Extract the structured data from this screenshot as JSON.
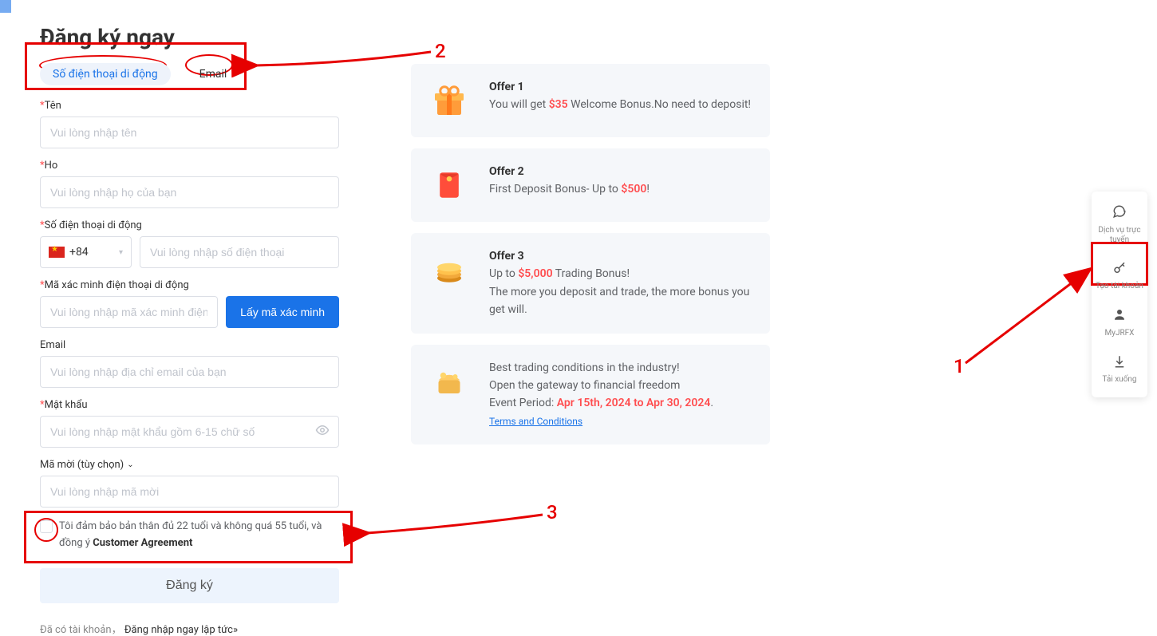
{
  "page_title": "Đăng ký ngay",
  "tabs": {
    "mobile": "Số điện thoại di động",
    "email": "Email"
  },
  "form": {
    "name_label": "Tên",
    "name_ph": "Vui lòng nhập tên",
    "lastname_label": "Ho",
    "lastname_ph": "Vui lòng nhập họ của bạn",
    "phone_label": "Số điện thoại di động",
    "phone_prefix": "+84",
    "phone_ph": "Vui lòng nhập số điện thoại",
    "verify_label": "Mã xác minh điện thoại di động",
    "verify_ph": "Vui lòng nhập mã xác minh điện thoại di động",
    "verify_btn": "Lấy mã xác minh",
    "email_label": "Email",
    "email_ph": "Vui lòng nhập địa chỉ email của bạn",
    "pw_label": "Mật khẩu",
    "pw_ph": "Vui lòng nhập mật khẩu gồm 6-15 chữ số",
    "invite_label": "Mã mời (tùy chọn)",
    "invite_ph": "Vui lòng nhập mã mời",
    "agree_text": "Tôi đảm bảo bản thân đủ 22 tuổi và không quá 55 tuổi, và đồng ý ",
    "agree_link": "Customer Agreement",
    "register_btn": "Đăng ký",
    "already_text": "Đã có tài khoản，",
    "login_now": "Đăng nhập ngay lập tức»"
  },
  "offers": {
    "o1_title": "Offer 1",
    "o1_pre": "You will get ",
    "o1_amt": "$35",
    "o1_post": " Welcome Bonus.No need to deposit!",
    "o2_title": "Offer 2",
    "o2_pre": "First Deposit Bonus- Up to ",
    "o2_amt": "$500",
    "o2_post": "!",
    "o3_title": "Offer 3",
    "o3_pre": "Up to ",
    "o3_amt": "$5,000",
    "o3_post": " Trading Bonus!",
    "o3_line2": "The more you deposit and trade, the more bonus you get will.",
    "o4_line1": "Best trading conditions in the industry!",
    "o4_line2": "Open the gateway to financial freedom",
    "o4_period_pre": "Event Period: ",
    "o4_period": "Apr 15th, 2024 to Apr 30, 2024",
    "o4_period_post": ".",
    "terms": "Terms and Conditions"
  },
  "dock": {
    "chat": "Dịch vụ trực tuyến",
    "create": "Tạo tài khoản",
    "myjrfx": "MyJRFX",
    "download": "Tải xuống"
  },
  "annotations": {
    "n1": "1",
    "n2": "2",
    "n3": "3"
  }
}
